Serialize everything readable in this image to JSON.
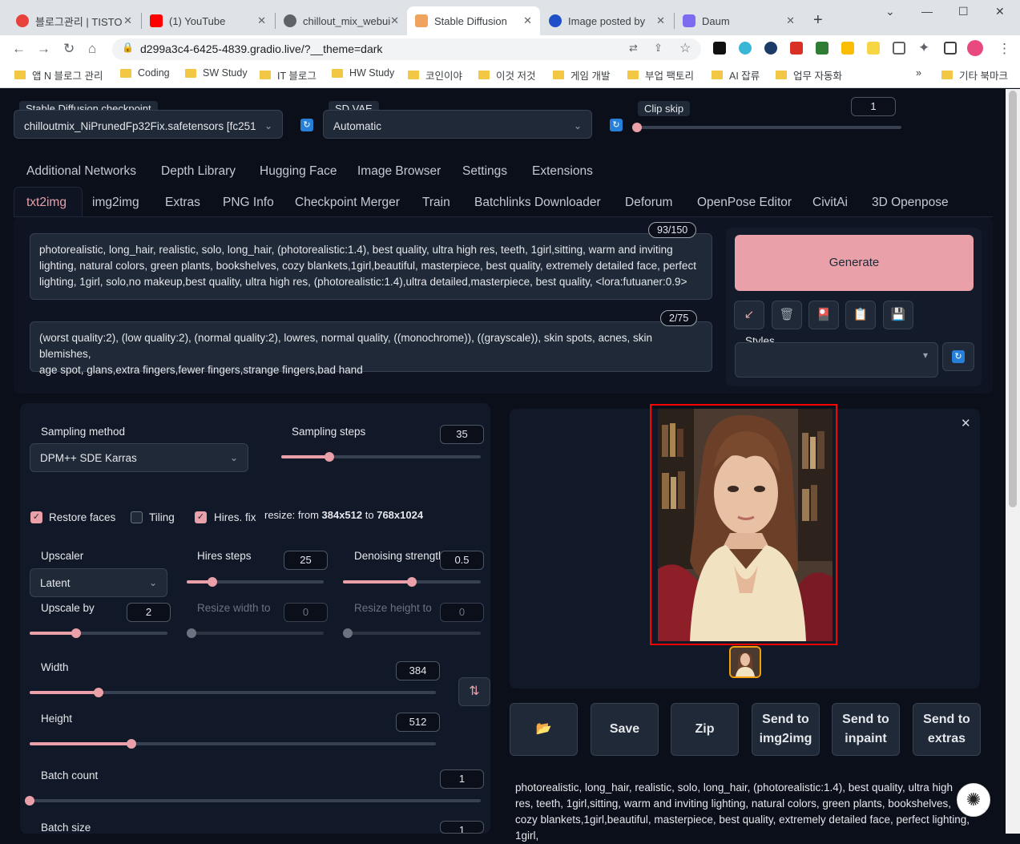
{
  "browser": {
    "tabs": [
      {
        "title": "블로그관리 | TISTO",
        "color": "#e8413c"
      },
      {
        "title": "(1) YouTube",
        "color": "#ff0000"
      },
      {
        "title": "chillout_mix_webui",
        "color": "#5f6368"
      },
      {
        "title": "Stable Diffusion",
        "color": "#f0a35e"
      },
      {
        "title": "Image posted by",
        "color": "#2050c8"
      },
      {
        "title": "Daum",
        "color": "#7b6cf0"
      }
    ],
    "url": "d299a3c4-6425-4839.gradio.live/?__theme=dark",
    "bookmarks": [
      "앱 N 블로그 관리",
      "Coding",
      "SW Study",
      "IT 블로그",
      "HW Study",
      "코인이야",
      "이것 저것",
      "게임 개발",
      "부업 팩토리",
      "AI 잡류",
      "업무 자동화",
      "기타 북마크"
    ]
  },
  "top": {
    "checkpoint_label": "Stable Diffusion checkpoint",
    "checkpoint_value": "chilloutmix_NiPrunedFp32Fix.safetensors [fc251",
    "vae_label": "SD VAE",
    "vae_value": "Automatic",
    "clip_label": "Clip skip",
    "clip_value": "1",
    "clip_level": 0
  },
  "nav_row1": [
    "Additional Networks",
    "Depth Library",
    "Hugging Face",
    "Image Browser",
    "Settings",
    "Extensions"
  ],
  "nav_row2": [
    "txt2img",
    "img2img",
    "Extras",
    "PNG Info",
    "Checkpoint Merger",
    "Train",
    "Batchlinks Downloader",
    "Deforum",
    "OpenPose Editor",
    "CivitAi",
    "3D Openpose"
  ],
  "prompt": {
    "counter": "93/150",
    "line1": "photorealistic, long_hair, realistic, solo, long_hair, (photorealistic:1.4), best quality, ultra high res, teeth, 1girl,sitting,  warm and inviting",
    "line2": "lighting, natural colors, green plants, bookshelves, cozy blankets,1girl,beautiful, masterpiece, best quality, extremely detailed face, perfect",
    "line3": "lighting, 1girl, solo,no makeup,best quality, ultra high res, (photorealistic:1.4),ultra detailed,masterpiece, best quality, <lora:futuaner:0.9>"
  },
  "negative": {
    "counter": "2/75",
    "line1": "(worst quality:2), (low quality:2), (normal quality:2), lowres, normal quality, ((monochrome)), ((grayscale)), skin spots, acnes, skin blemishes,",
    "line2": "age spot, glans,extra fingers,fewer fingers,strange fingers,bad hand"
  },
  "generate_label": "Generate",
  "styles_label": "Styles",
  "tool_icons": [
    "arrow-icon",
    "trash-icon",
    "card-icon",
    "clipboard-icon",
    "save-icon"
  ],
  "sampling": {
    "method_label": "Sampling method",
    "method_value": "DPM++ SDE Karras",
    "steps_label": "Sampling steps",
    "steps_value": "35",
    "steps_level": 0.24
  },
  "checks": {
    "restore_faces": "Restore faces",
    "tiling": "Tiling",
    "hires_fix": "Hires. fix",
    "resize_prefix": "resize: from ",
    "resize_from": "384x512",
    "resize_mid": " to ",
    "resize_to": "768x1024"
  },
  "hires": {
    "upscaler_label": "Upscaler",
    "upscaler_value": "Latent",
    "steps_label": "Hires steps",
    "steps_value": "25",
    "steps_level": 0.19,
    "denoise_label": "Denoising strength",
    "denoise_value": "0.5",
    "denoise_level": 0.5,
    "upscale_label": "Upscale by",
    "upscale_value": "2",
    "upscale_level": 0.34,
    "rw_label": "Resize width to",
    "rw_value": "0",
    "rh_label": "Resize height to",
    "rh_value": "0"
  },
  "size": {
    "width_label": "Width",
    "width_value": "384",
    "width_level": 0.17,
    "height_label": "Height",
    "height_value": "512",
    "height_level": 0.25
  },
  "batch": {
    "count_label": "Batch count",
    "count_value": "1",
    "count_level": 0,
    "size_label": "Batch size",
    "size_value": "1"
  },
  "output_buttons": [
    "Save",
    "Zip",
    "Send to img2img",
    "Send to inpaint",
    "Send to extras"
  ],
  "output_text": "photorealistic, long_hair, realistic, solo, long_hair, (photorealistic:1.4), best quality, ultra high res, teeth, 1girl,sitting, warm and inviting lighting, natural colors, green plants, bookshelves, cozy blankets,1girl,beautiful, masterpiece, best quality, extremely detailed face, perfect lighting, 1girl,"
}
